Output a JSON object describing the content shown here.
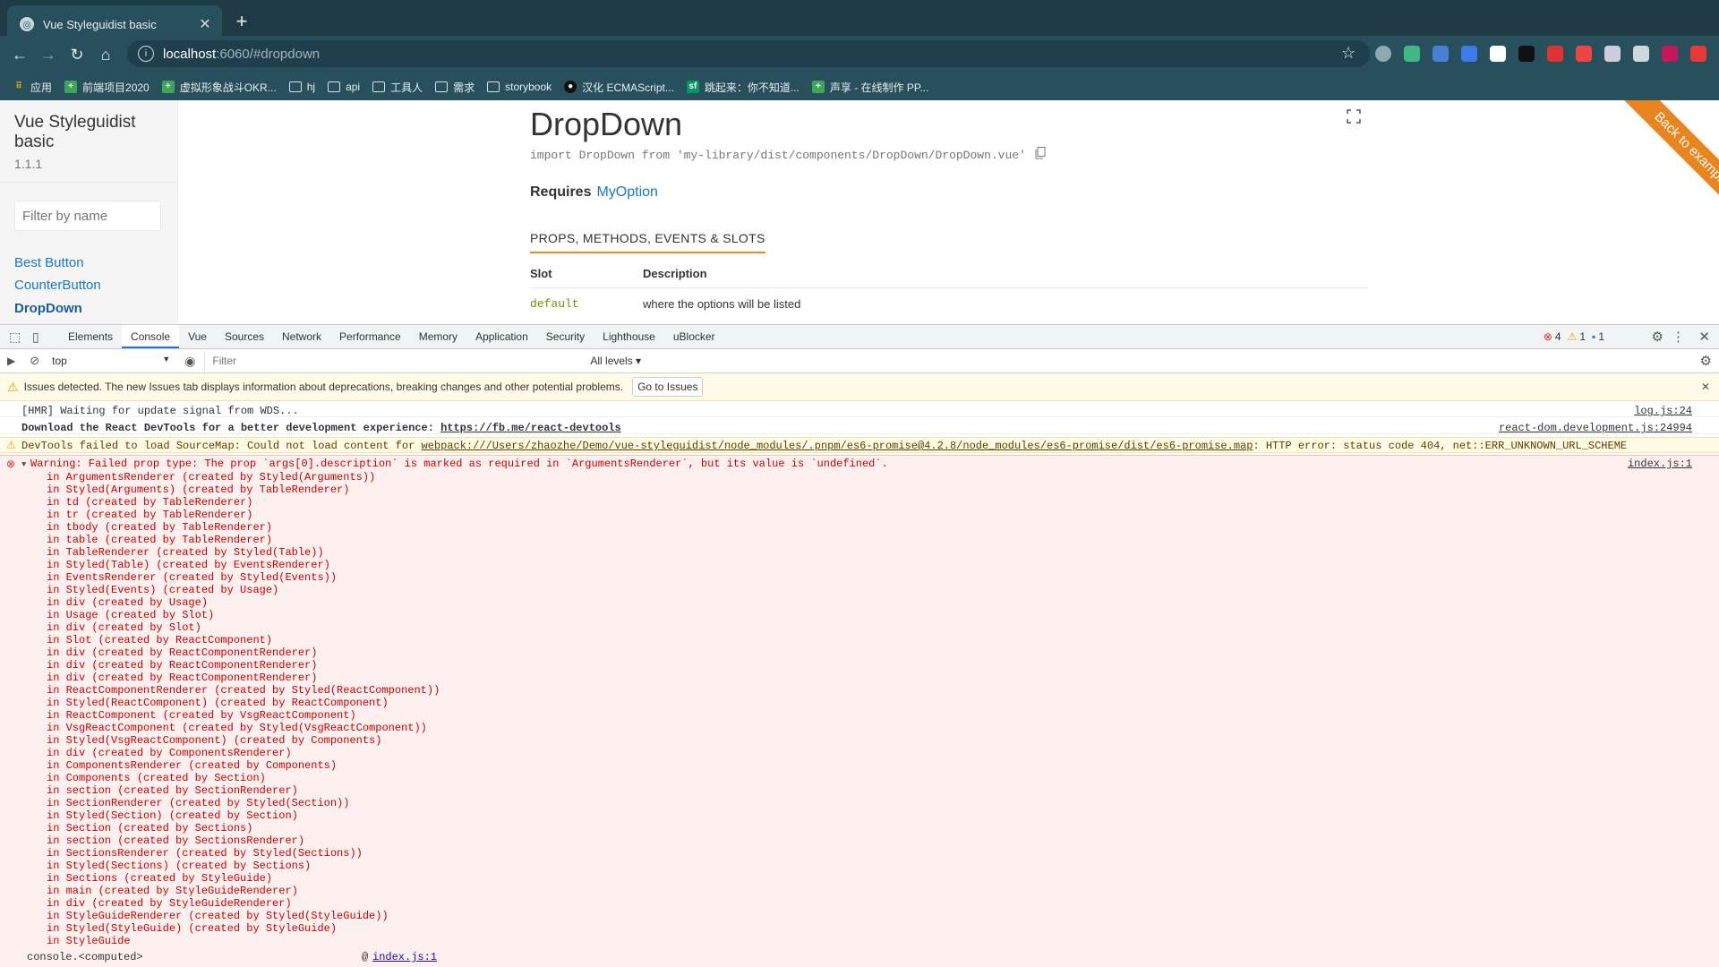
{
  "browser": {
    "tab_title": "Vue Styleguidist basic",
    "url_host": "localhost",
    "url_path": ":6060/#dropdown",
    "bookmarks": [
      {
        "label": "应用",
        "kind": "apps"
      },
      {
        "label": "前端项目2020",
        "kind": "green"
      },
      {
        "label": "虚拟形象战斗OKR...",
        "kind": "green"
      },
      {
        "label": "hj",
        "kind": "folder"
      },
      {
        "label": "api",
        "kind": "folder"
      },
      {
        "label": "工具人",
        "kind": "folder"
      },
      {
        "label": "需求",
        "kind": "folder"
      },
      {
        "label": "storybook",
        "kind": "folder"
      },
      {
        "label": "汉化 ECMAScript...",
        "kind": "github"
      },
      {
        "label": "跳起来：你不知道...",
        "kind": "sf"
      },
      {
        "label": "声享 - 在线制作 PP...",
        "kind": "green"
      }
    ],
    "extension_colors": [
      "#8fa9b2",
      "#41b883",
      "#4a7fd6",
      "#3c7be8",
      "#ffffff",
      "#111111",
      "#d33",
      "#e44",
      "#ccd",
      "#cfd8dc",
      "#c2185b",
      "#e53935"
    ]
  },
  "sidebar": {
    "title": "Vue Styleguidist basic",
    "version": "1.1.1",
    "filter_placeholder": "Filter by name",
    "items": [
      {
        "label": "Best Button",
        "active": false
      },
      {
        "label": "CounterButton",
        "active": false
      },
      {
        "label": "DropDown",
        "active": true
      }
    ]
  },
  "content": {
    "title": "DropDown",
    "import_line": "import DropDown from 'my-library/dist/components/DropDown/DropDown.vue'",
    "requires_label": "Requires",
    "requires_link": "MyOption",
    "section_tab": "PROPS, METHODS, EVENTS & SLOTS",
    "table": {
      "headers": [
        "Slot",
        "Description"
      ],
      "rows": [
        [
          "default",
          "where the options will be listed"
        ]
      ]
    },
    "ribbon": "Back to examples"
  },
  "devtools": {
    "tabs": [
      "Elements",
      "Console",
      "Vue",
      "Sources",
      "Network",
      "Performance",
      "Memory",
      "Application",
      "Security",
      "Lighthouse",
      "uBlocker"
    ],
    "active_tab": "Console",
    "error_count": "4",
    "warning_count": "1",
    "info_count": "1",
    "context": "top",
    "filter_placeholder": "Filter",
    "levels": "All levels",
    "issues_text": "Issues detected. The new Issues tab displays information about deprecations, breaking changes and other potential problems.",
    "issues_button": "Go to Issues",
    "logs": [
      {
        "text": "[HMR] Waiting for update signal from WDS...",
        "src": "log.js:24"
      },
      {
        "text": "Download the React DevTools for a better development experience: ",
        "link": "https://fb.me/react-devtools",
        "src": "react-dom.development.js:24994"
      },
      {
        "text": "DevTools failed to load SourceMap: Could not load content for ",
        "link": "webpack:///Users/zhaozhe/Demo/vue-styleguidist/node_modules/.pnpm/es6-promise@4.2.8/node_modules/es6-promise/dist/es6-promise.map",
        "tail": ": HTTP error: status code 404, net::ERR_UNKNOWN_URL_SCHEME"
      },
      {
        "text": "Warning: Failed prop type: The prop `args[0].description` is marked as required in `ArgumentsRenderer`, but its value is `undefined`.",
        "src": "index.js:1"
      }
    ],
    "stack": [
      "in ArgumentsRenderer (created by Styled(Arguments))",
      "in Styled(Arguments) (created by TableRenderer)",
      "in td (created by TableRenderer)",
      "in tr (created by TableRenderer)",
      "in tbody (created by TableRenderer)",
      "in table (created by TableRenderer)",
      "in TableRenderer (created by Styled(Table))",
      "in Styled(Table) (created by EventsRenderer)",
      "in EventsRenderer (created by Styled(Events))",
      "in Styled(Events) (created by Usage)",
      "in div (created by Usage)",
      "in Usage (created by Slot)",
      "in div (created by Slot)",
      "in Slot (created by ReactComponent)",
      "in div (created by ReactComponentRenderer)",
      "in div (created by ReactComponentRenderer)",
      "in div (created by ReactComponentRenderer)",
      "in ReactComponentRenderer (created by Styled(ReactComponent))",
      "in Styled(ReactComponent) (created by ReactComponent)",
      "in ReactComponent (created by VsgReactComponent)",
      "in VsgReactComponent (created by Styled(VsgReactComponent))",
      "in Styled(VsgReactComponent) (created by Components)",
      "in div (created by ComponentsRenderer)",
      "in ComponentsRenderer (created by Components)",
      "in Components (created by Section)",
      "in section (created by SectionRenderer)",
      "in SectionRenderer (created by Styled(Section))",
      "in Styled(Section) (created by Section)",
      "in Section (created by Sections)",
      "in section (created by SectionsRenderer)",
      "in SectionsRenderer (created by Styled(Sections))",
      "in Styled(Sections) (created by Sections)",
      "in Sections (created by StyleGuide)",
      "in main (created by StyleGuideRenderer)",
      "in div (created by StyleGuideRenderer)",
      "in StyleGuideRenderer (created by Styled(StyleGuide))",
      "in Styled(StyleGuide) (created by StyleGuide)",
      "in StyleGuide"
    ],
    "computed_label": "console.<computed>",
    "computed_at": "@",
    "computed_src": "index.js:1"
  }
}
